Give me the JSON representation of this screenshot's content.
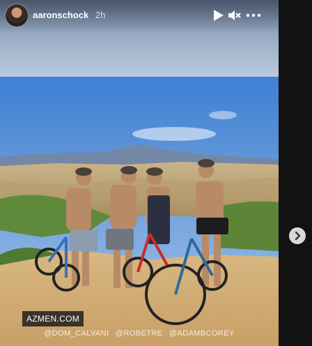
{
  "story": {
    "username": "aaronschock",
    "timestamp": "2h",
    "watermark": "AZMEN.COM",
    "credits": [
      "@DOM_CALVANI",
      "@ROBETRE",
      "@ADAMBCOREY"
    ]
  },
  "controls": {
    "play": "play-icon",
    "mute": "muted-speaker-icon",
    "more": "more-options-icon",
    "next": "chevron-right-icon"
  },
  "colors": {
    "page_background": "#121212",
    "sky": "#b9c9de",
    "next_button": "#d8d8d8"
  }
}
